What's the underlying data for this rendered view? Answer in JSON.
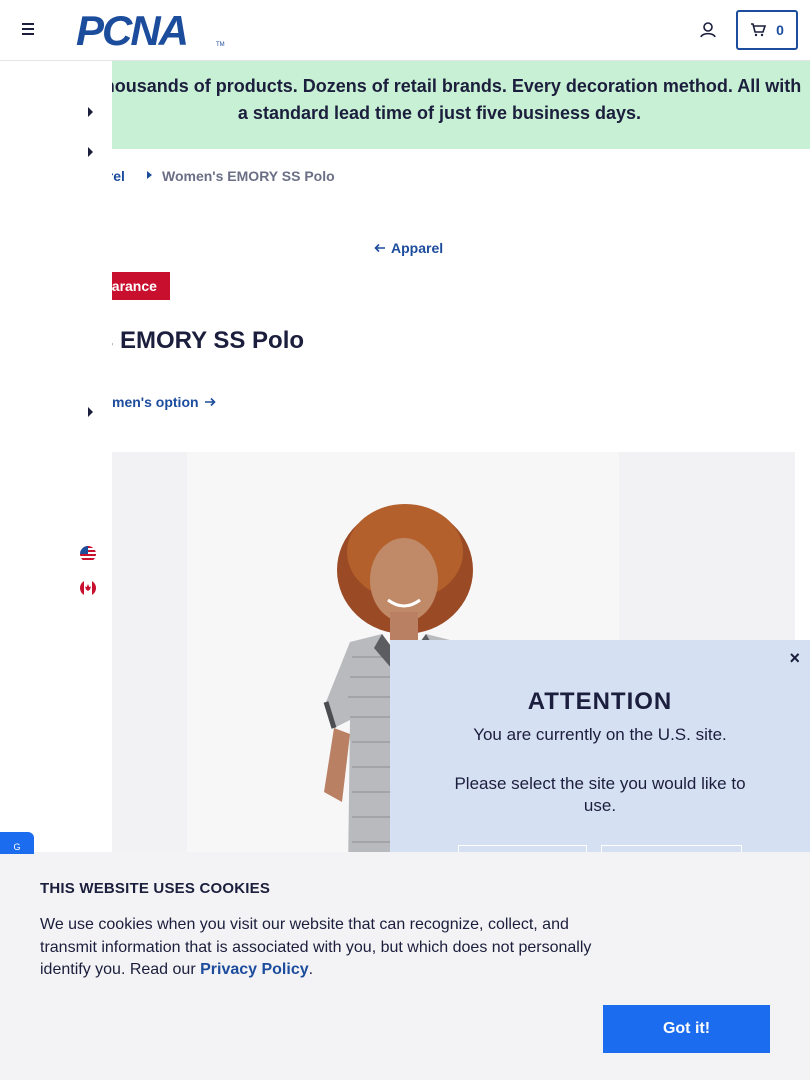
{
  "header": {
    "logo_text": "PCNA",
    "logo_tm": "TM",
    "cart_count": "0"
  },
  "promo": {
    "text": "y Thousands of products. Dozens of retail brands. Every decoration method. All with a standard lead time of just five business days."
  },
  "breadcrumb": {
    "parent": "arel",
    "current": "Women's EMORY SS Polo"
  },
  "back_link": "Apparel",
  "badge": "earance",
  "product_title": "s EMORY SS Polo",
  "mens_option": "men's option",
  "modal": {
    "close": "×",
    "title": "ATTENTION",
    "message": "You are currently on the U.S. site.",
    "prompt": "Please select the site you would like to use."
  },
  "cookie": {
    "title": "THIS WEBSITE USES COOKIES",
    "text_before": "We use cookies when you visit our website that can recognize, collect, and transmit information that is associated with you, but which does not personally identify you. Read our ",
    "link": "Privacy Policy",
    "text_after": ".",
    "button": "Got it!"
  },
  "side_tab": "G",
  "colors": {
    "brand_blue": "#1c4c9c",
    "promo_green": "#c8f0d4",
    "badge_red": "#c8102e",
    "modal_bg": "#d6e0f3",
    "cookie_button": "#1c6cf0"
  },
  "icons": [
    "menu-icon",
    "user-icon",
    "cart-icon",
    "caret-right-icon",
    "arrow-left-icon",
    "arrow-right-icon",
    "us-flag-icon",
    "canada-flag-icon",
    "close-icon"
  ]
}
